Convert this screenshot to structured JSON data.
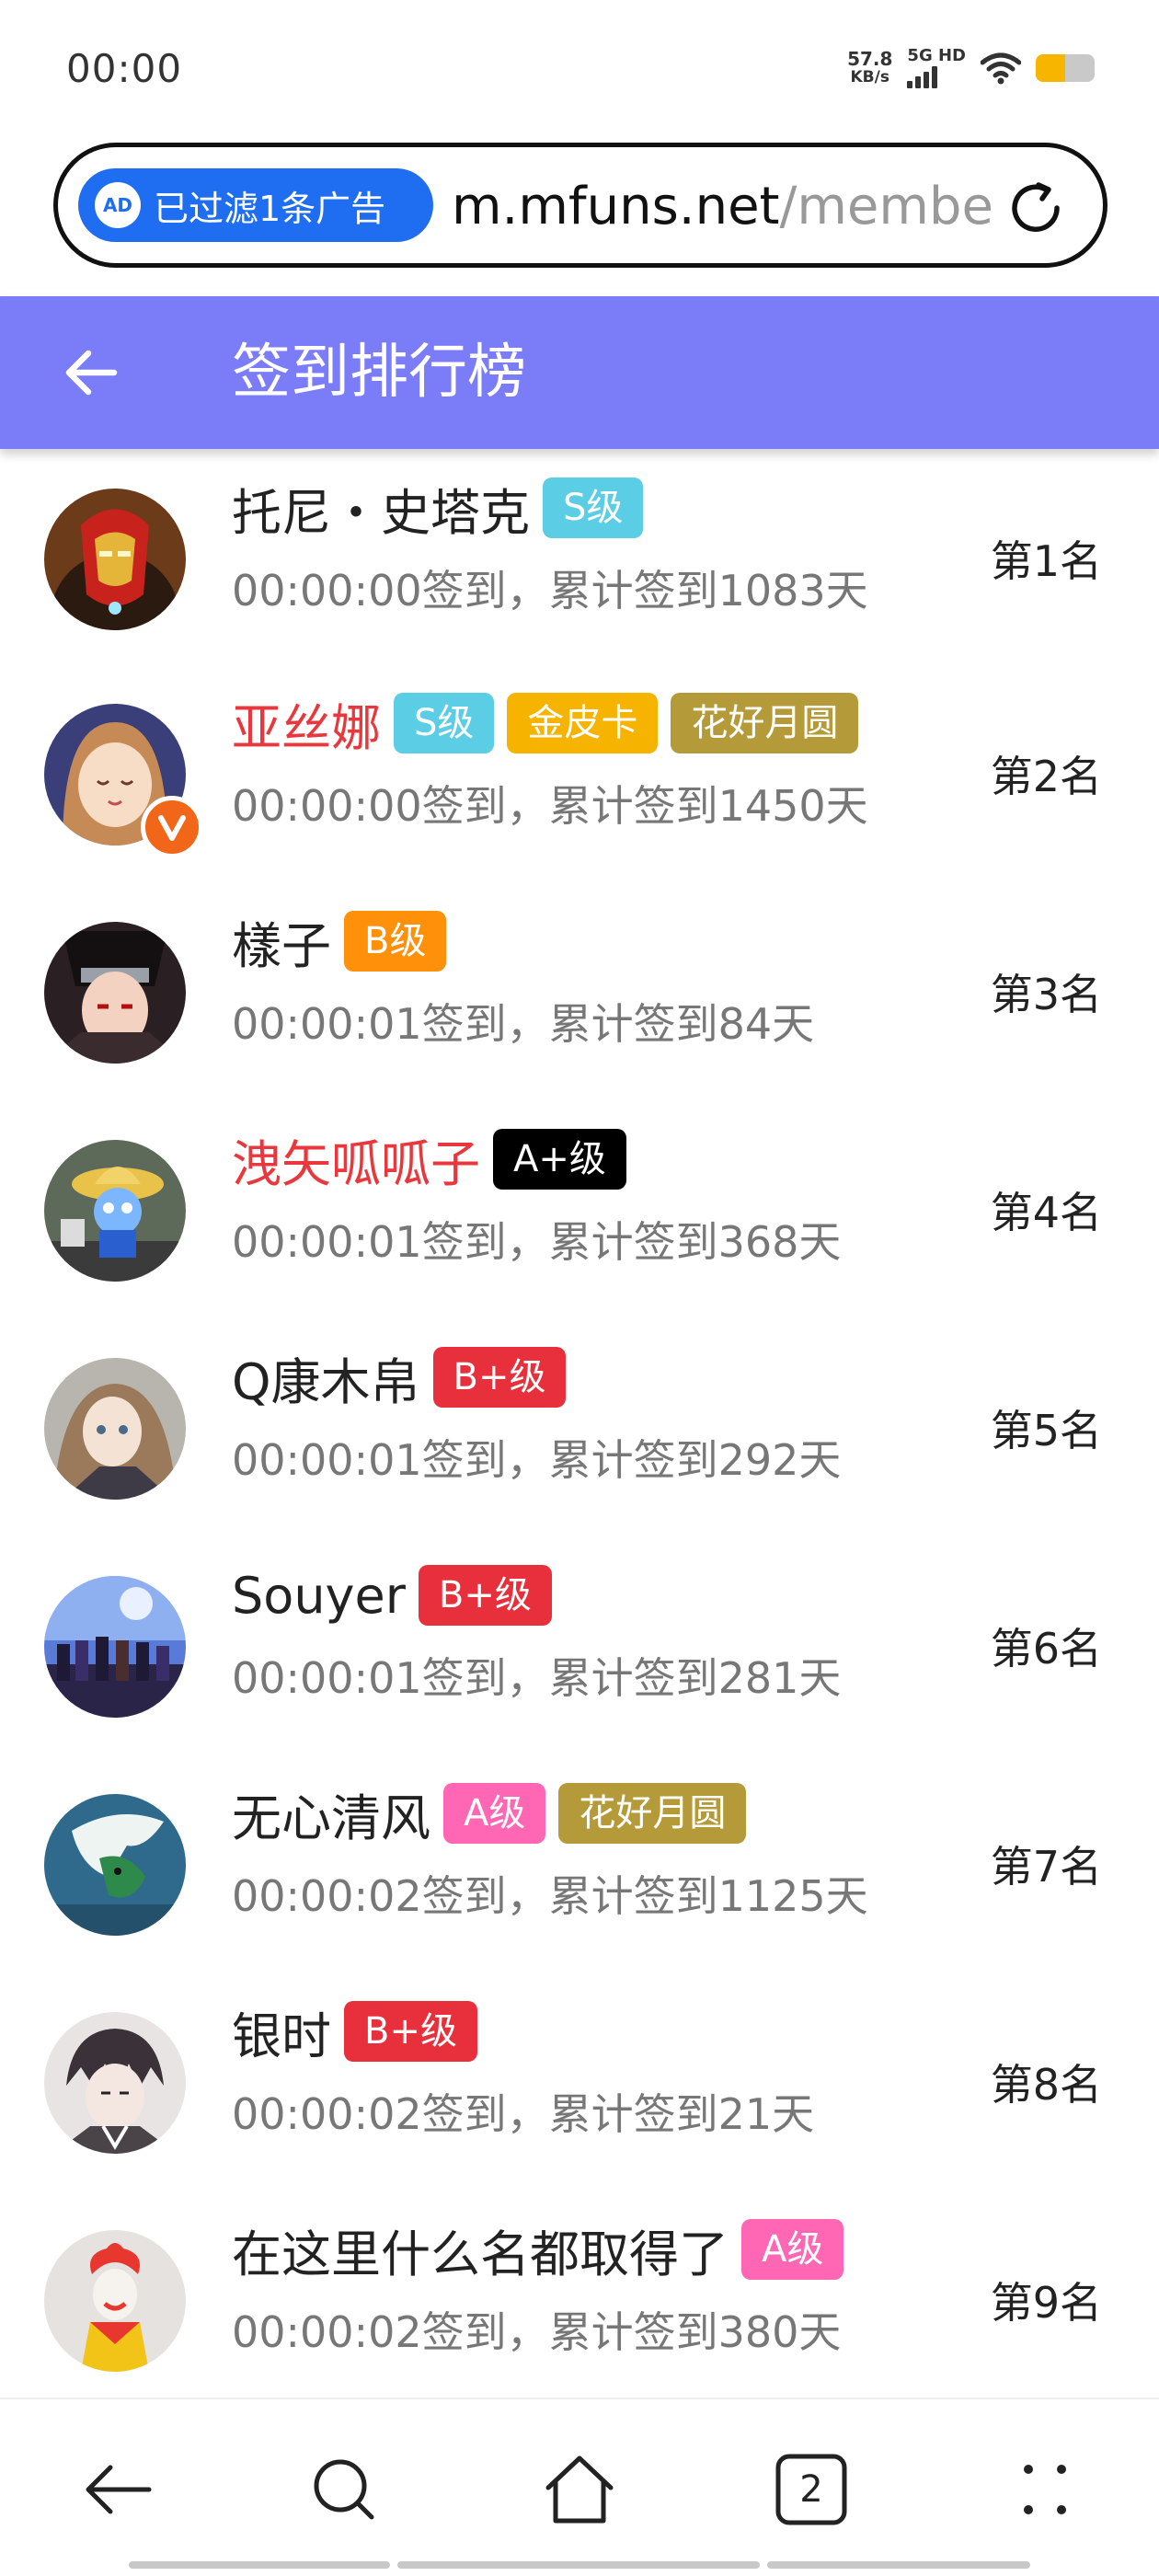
{
  "status_bar": {
    "time": "00:00",
    "net_speed_value": "57.8",
    "net_speed_unit": "KB/s",
    "network_type": "5G HD",
    "battery_level": 0.5
  },
  "browser": {
    "ad_filter_label": "已过滤1条广告",
    "ad_icon_text": "AD",
    "url_host": "m.mfuns.net",
    "url_path": "/membe"
  },
  "header": {
    "title": "签到排行榜"
  },
  "rankings": [
    {
      "name": "托尼・史塔克",
      "name_color": "#222222",
      "tags": [
        {
          "label": "S级",
          "color": "#5bcde5"
        }
      ],
      "sub": "00:00:00签到，累计签到1083天",
      "rank": "第1名"
    },
    {
      "name": "亚丝娜",
      "name_color": "#e8383d",
      "verified": true,
      "tags": [
        {
          "label": "S级",
          "color": "#5bcde5"
        },
        {
          "label": "金皮卡",
          "color": "#f6b300"
        },
        {
          "label": "花好月圆",
          "color": "#b59a3a"
        }
      ],
      "sub": "00:00:00签到，累计签到1450天",
      "rank": "第2名"
    },
    {
      "name": "樣子",
      "name_color": "#222222",
      "tags": [
        {
          "label": "B级",
          "color": "#ff9009"
        }
      ],
      "sub": "00:00:01签到，累计签到84天",
      "rank": "第3名"
    },
    {
      "name": "洩矢呱呱子",
      "name_color": "#e8383d",
      "tags": [
        {
          "label": "A+级",
          "color": "#000000"
        }
      ],
      "sub": "00:00:01签到，累计签到368天",
      "rank": "第4名"
    },
    {
      "name": "Q康木帛",
      "name_color": "#222222",
      "tags": [
        {
          "label": "B+级",
          "color": "#e8303c"
        }
      ],
      "sub": "00:00:01签到，累计签到292天",
      "rank": "第5名"
    },
    {
      "name": "Souyer",
      "name_color": "#222222",
      "tags": [
        {
          "label": "B+级",
          "color": "#e8303c"
        }
      ],
      "sub": "00:00:01签到，累计签到281天",
      "rank": "第6名"
    },
    {
      "name": "无心清风",
      "name_color": "#222222",
      "tags": [
        {
          "label": "A级",
          "color": "#ff66b4"
        },
        {
          "label": "花好月圆",
          "color": "#b59a3a"
        }
      ],
      "sub": "00:00:02签到，累计签到1125天",
      "rank": "第7名"
    },
    {
      "name": "银时",
      "name_color": "#222222",
      "tags": [
        {
          "label": "B+级",
          "color": "#e8303c"
        }
      ],
      "sub": "00:00:02签到，累计签到21天",
      "rank": "第8名"
    },
    {
      "name": "在这里什么名都取得了",
      "name_color": "#222222",
      "tags": [
        {
          "label": "A级",
          "color": "#ff66b4"
        }
      ],
      "sub": "00:00:02签到，累计签到380天",
      "rank": "第9名"
    }
  ],
  "bottom_nav": {
    "tab_count": "2",
    "icons": [
      "back-icon",
      "search-icon",
      "home-icon",
      "tabs-icon",
      "menu-icon"
    ]
  },
  "colors": {
    "header_bg": "#7b7cf7",
    "ad_pill": "#1f6ef2",
    "verified_badge": "#f2661a"
  }
}
